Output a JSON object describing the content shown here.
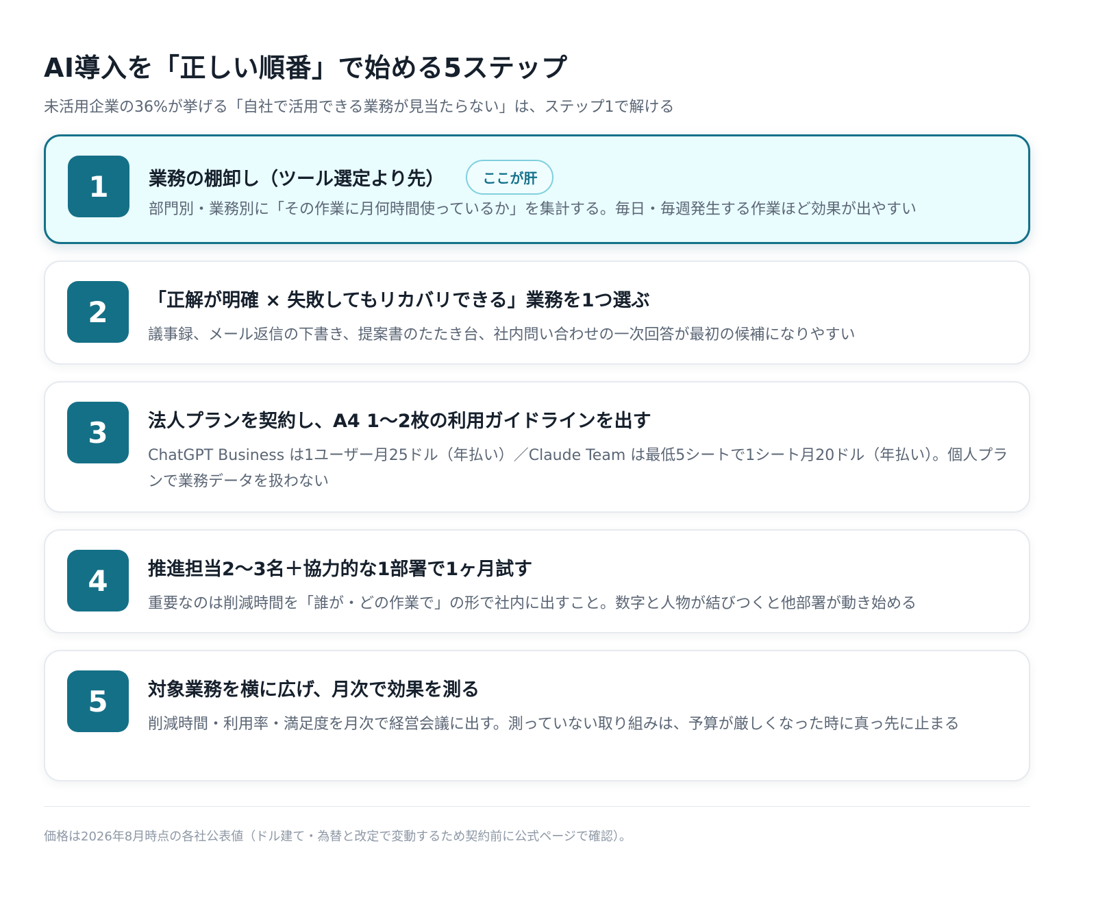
{
  "header": {
    "title": "AI導入を「正しい順番」で始める5ステップ",
    "subtitle": "未活用企業の36%が挙げる「自社で活用できる業務が見当たらない」は、ステップ1で解ける"
  },
  "steps": [
    {
      "number": "1",
      "title": "業務の棚卸し（ツール選定より先）",
      "badge": "ここが肝",
      "desc": "部門別・業務別に「その作業に月何時間使っているか」を集計する。毎日・毎週発生する作業ほど効果が出やすい",
      "highlighted": true
    },
    {
      "number": "2",
      "title": "「正解が明確 × 失敗してもリカバリできる」業務を1つ選ぶ",
      "desc": "議事録、メール返信の下書き、提案書のたたき台、社内問い合わせの一次回答が最初の候補になりやすい"
    },
    {
      "number": "3",
      "title": "法人プランを契約し、A4 1〜2枚の利用ガイドラインを出す",
      "desc": "ChatGPT Business は1ユーザー月25ドル（年払い）／Claude Team は最低5シートで1シート月20ドル（年払い）。個人プランで業務データを扱わない"
    },
    {
      "number": "4",
      "title": "推進担当2〜3名＋協力的な1部署で1ヶ月試す",
      "desc": "重要なのは削減時間を「誰が・どの作業で」の形で社内に出すこと。数字と人物が結びつくと他部署が動き始める"
    },
    {
      "number": "5",
      "title": "対象業務を横に広げ、月次で効果を測る",
      "desc": "削減時間・利用率・満足度を月次で経営会議に出す。測っていない取り組みは、予算が厳しくなった時に真っ先に止まる"
    }
  ],
  "footer": {
    "note": "価格は2026年8月時点の各社公表値（ドル建て・為替と改定で変動するため契約前に公式ページで確認）。"
  },
  "colors": {
    "accent": "#147087",
    "highlight_bg": "#e9fcfe",
    "text": "#16202c",
    "muted": "#5b6675"
  }
}
